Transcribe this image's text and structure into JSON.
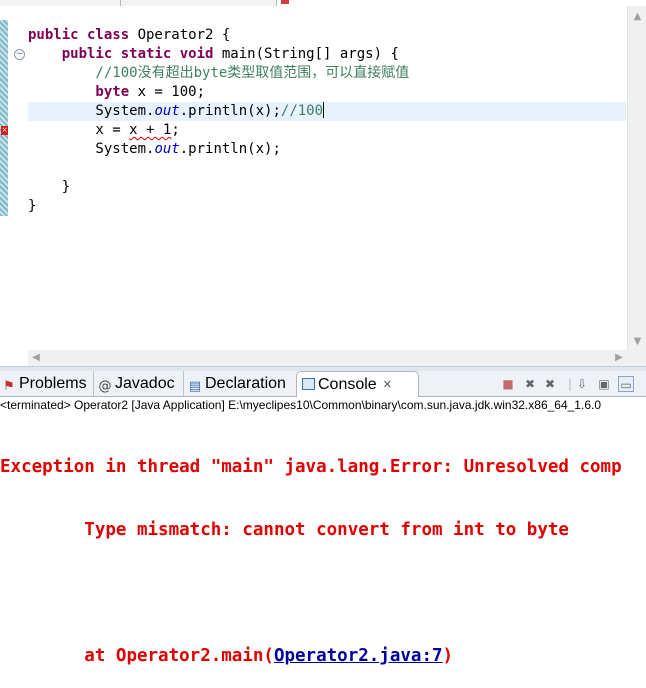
{
  "editor": {
    "code_lines": [
      [
        {
          "t": "public class ",
          "k": "kw"
        },
        {
          "t": "Operator2 {",
          "k": ""
        }
      ],
      [
        {
          "t": "    public static void ",
          "k": "kw"
        },
        {
          "t": "main(String[] args) {",
          "k": ""
        }
      ],
      [
        {
          "t": "        //100没有超出byte类型取值范围，可以直接赋值",
          "k": "cm"
        }
      ],
      [
        {
          "t": "        byte ",
          "k": "kw"
        },
        {
          "t": "x = 100;",
          "k": ""
        }
      ],
      [
        {
          "t": "        System.",
          "k": ""
        },
        {
          "t": "out",
          "k": "fld"
        },
        {
          "t": ".println(x);",
          "k": ""
        },
        {
          "t": "//100",
          "k": "cm"
        },
        {
          "t": "",
          "k": "caret"
        }
      ],
      [
        {
          "t": "        x = ",
          "k": ""
        },
        {
          "t": "x + 1",
          "k": "err"
        },
        {
          "t": ";",
          "k": ""
        }
      ],
      [
        {
          "t": "        System.",
          "k": ""
        },
        {
          "t": "out",
          "k": "fld"
        },
        {
          "t": ".println(x);",
          "k": ""
        }
      ],
      [
        {
          "t": "",
          "k": ""
        }
      ],
      [
        {
          "t": "    }",
          "k": ""
        }
      ],
      [
        {
          "t": "}",
          "k": ""
        }
      ]
    ]
  },
  "bottom_tabs": {
    "problems": "Problems",
    "javadoc": "Javadoc",
    "declaration": "Declaration",
    "console": "Console"
  },
  "console": {
    "status": "<terminated> Operator2 [Java Application] E:\\myeclipes10\\Common\\binary\\com.sun.java.jdk.win32.x86_64_1.6.0",
    "line1": "Exception in thread \"main\" java.lang.Error: Unresolved comp",
    "line2": "\tType mismatch: cannot convert from int to byte",
    "line4_prefix": "\tat Operator2.main(",
    "line4_link": "Operator2.java:7",
    "line4_suffix": ")"
  },
  "icons": {
    "problems_tab": "problems-icon",
    "javadoc_tab": "at-sign-icon",
    "declaration_tab": "declaration-icon",
    "console_tab": "console-icon"
  }
}
